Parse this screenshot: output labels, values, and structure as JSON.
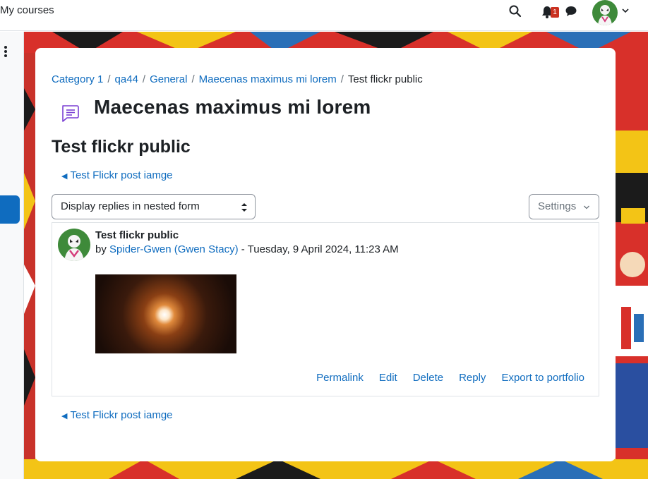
{
  "navbar": {
    "my_courses": "My courses",
    "notification_count": "1",
    "icons": [
      "search-icon",
      "bell-icon",
      "chat-icon",
      "avatar",
      "chevron-down-icon"
    ]
  },
  "colors": {
    "link": "#0f6cbf",
    "text": "#1d2125",
    "badge": "#ca3120",
    "forum_icon": "#7a3fd3"
  },
  "breadcrumb": [
    {
      "label": "Category 1"
    },
    {
      "label": "qa44"
    },
    {
      "label": "General"
    },
    {
      "label": "Maecenas maximus mi lorem"
    },
    {
      "label": "Test flickr public"
    }
  ],
  "page": {
    "title": "Maecenas maximus mi lorem",
    "discussion_title": "Test flickr public",
    "prev_link": "Test Flickr post iamge",
    "display_mode": "Display replies in nested form",
    "settings_label": "Settings"
  },
  "post": {
    "subject": "Test flickr public",
    "by": "by",
    "author": "Spider-Gwen (Gwen Stacy)",
    "date": "- Tuesday, 9 April 2024, 11:23 AM",
    "actions": [
      "Permalink",
      "Edit",
      "Delete",
      "Reply",
      "Export to portfolio"
    ]
  }
}
